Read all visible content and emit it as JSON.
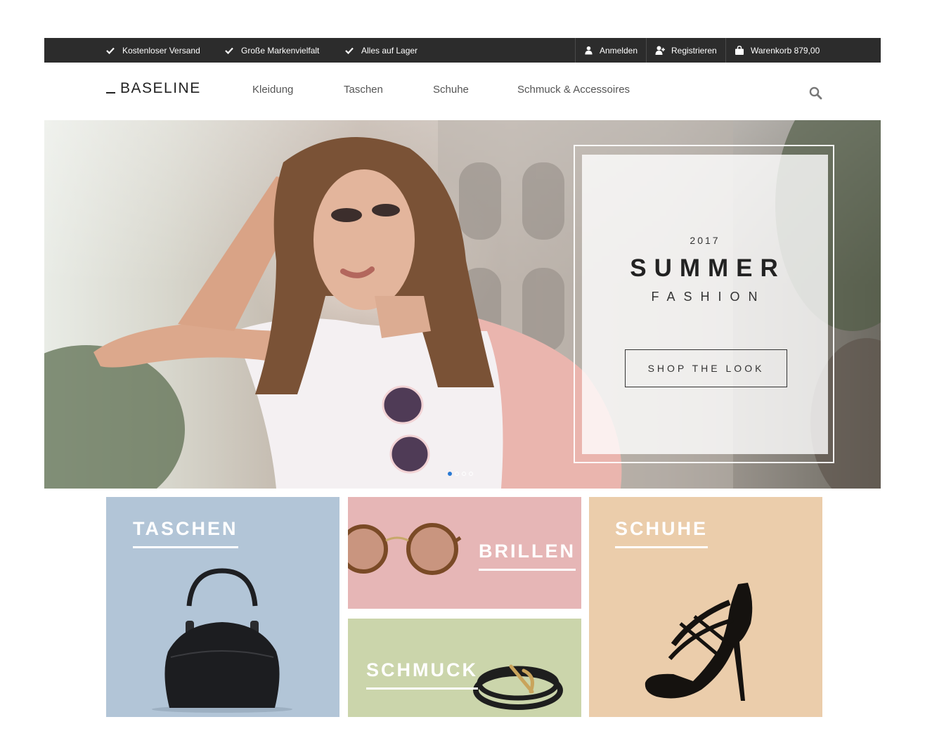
{
  "topbar": {
    "usps": [
      "Kostenloser Versand",
      "Große Markenvielfalt",
      "Alles auf Lager"
    ],
    "login": "Anmelden",
    "register": "Registrieren",
    "cart": "Warenkorb 879,00"
  },
  "header": {
    "logo": "BASELINE",
    "nav": [
      "Kleidung",
      "Taschen",
      "Schuhe",
      "Schmuck & Accessoires"
    ]
  },
  "hero": {
    "year": "2017",
    "title": "SUMMER",
    "subtitle": "FASHION",
    "cta": "SHOP THE LOOK",
    "slides": 4,
    "active_slide": 1
  },
  "tiles": {
    "taschen": "TASCHEN",
    "brillen": "BRILLEN",
    "schmuck": "SCHMUCK",
    "schuhe": "SCHUHE"
  },
  "colors": {
    "topbar": "#2c2c2c",
    "taschen_bg": "#b2c5d7",
    "brillen_bg": "#e6b6b6",
    "schmuck_bg": "#cbd5ab",
    "schuhe_bg": "#ebcdab",
    "slider_active": "#2a7ad4"
  },
  "icons": {
    "usp": "check-icon",
    "login": "user-icon",
    "register": "user-plus-icon",
    "cart": "shopping-bag-icon",
    "search": "search-icon"
  }
}
